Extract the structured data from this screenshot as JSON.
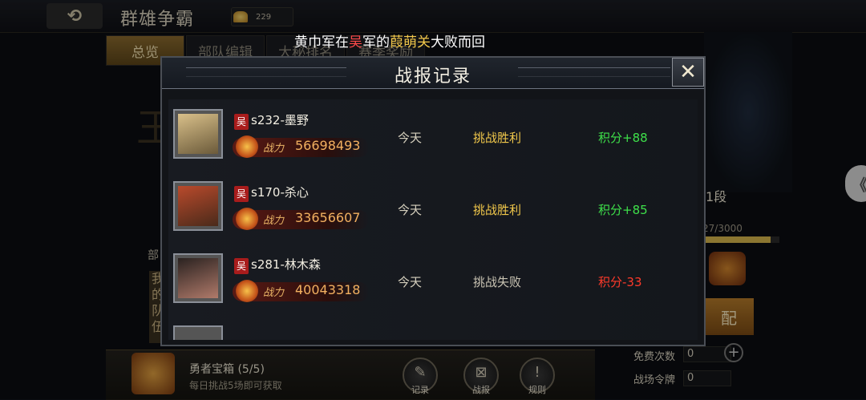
{
  "header": {
    "title": "群雄争霸",
    "gold": "229"
  },
  "tabs": [
    "总览",
    "部队编辑",
    "大秘排名",
    "赛季奖励"
  ],
  "ticker": {
    "p1": "黄巾军在",
    "faction": "吴",
    "p2": "军的",
    "place": "葭萌关",
    "p3": "大败而回"
  },
  "side": {
    "label": "部",
    "col": "我的队伍"
  },
  "rank": {
    "text": "1段",
    "progress_text": "27/3000",
    "progress_fraction": 0.88,
    "match_label": "配"
  },
  "modal": {
    "title": "战报记录",
    "close_glyph": "✕",
    "rows": [
      {
        "faction": "吴",
        "name": "s232-墨野",
        "power_label": "战力",
        "power": "56698493",
        "date": "今天",
        "result": "挑战胜利",
        "score": "积分+88",
        "result_type": "win"
      },
      {
        "faction": "吴",
        "name": "s170-杀心",
        "power_label": "战力",
        "power": "33656607",
        "date": "今天",
        "result": "挑战胜利",
        "score": "积分+85",
        "result_type": "win"
      },
      {
        "faction": "吴",
        "name": "s281-林木森",
        "power_label": "战力",
        "power": "40043318",
        "date": "今天",
        "result": "挑战失败",
        "score": "积分-33",
        "result_type": "lose"
      }
    ]
  },
  "bottom": {
    "chest_title": "勇者宝箱 (5/5)",
    "chest_desc": "每日挑战5场即可获取",
    "buttons": [
      {
        "label": "记录",
        "icon": "record-icon"
      },
      {
        "label": "战报",
        "icon": "report-icon"
      },
      {
        "label": "规则",
        "icon": "rules-icon"
      }
    ]
  },
  "stats": {
    "free_label": "免费次数",
    "free_val": "0",
    "token_label": "战场令牌",
    "token_val": "0"
  },
  "colors": {
    "win": "#f2c84b",
    "score_pos": "#3ee04a",
    "score_neg": "#ff3a2a",
    "faction": "#a81c1c"
  }
}
